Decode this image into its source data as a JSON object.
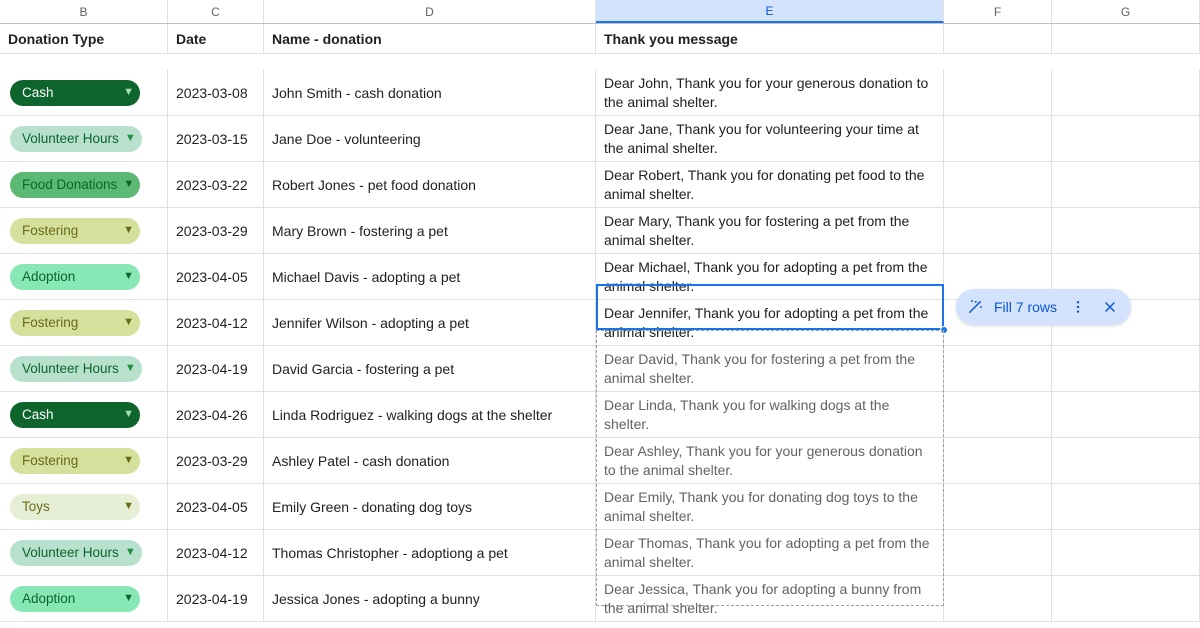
{
  "columns": [
    "B",
    "C",
    "D",
    "E",
    "F",
    "G"
  ],
  "selected_column_index": 3,
  "headers": {
    "donation_type": "Donation Type",
    "date": "Date",
    "name_donation": "Name - donation",
    "thank_you": "Thank you message"
  },
  "rows": [
    {
      "type": "Cash",
      "type_style": "cash",
      "date": "2023-03-08",
      "name": "John Smith - cash donation",
      "msg": "Dear John, Thank you for your generous donation to the animal shelter.",
      "suggested": false
    },
    {
      "type": "Volunteer Hours",
      "type_style": "vol",
      "date": "2023-03-15",
      "name": "Jane Doe - volunteering",
      "msg": "Dear Jane, Thank you for volunteering your time at the animal shelter.",
      "suggested": false
    },
    {
      "type": "Food Donations",
      "type_style": "food",
      "date": "2023-03-22",
      "name": "Robert Jones - pet food donation",
      "msg": "Dear Robert, Thank you for donating pet food to the animal shelter.",
      "suggested": false
    },
    {
      "type": "Fostering",
      "type_style": "fost",
      "date": "2023-03-29",
      "name": "Mary Brown - fostering a pet",
      "msg": "Dear Mary, Thank you for fostering a pet from the animal shelter.",
      "suggested": false
    },
    {
      "type": "Adoption",
      "type_style": "adopt",
      "date": "2023-04-05",
      "name": "Michael Davis - adopting a pet",
      "msg": "Dear Michael, Thank you for adopting a pet from the animal shelter.",
      "suggested": false
    },
    {
      "type": "Fostering",
      "type_style": "fost",
      "date": "2023-04-12",
      "name": "Jennifer Wilson - adopting a pet",
      "msg": "Dear Jennifer, Thank you for adopting a pet from the animal shelter.",
      "suggested": false,
      "active": true
    },
    {
      "type": "Volunteer Hours",
      "type_style": "vol",
      "date": "2023-04-19",
      "name": "David Garcia - fostering a pet",
      "msg": "Dear David, Thank you for fostering a pet from the animal shelter.",
      "suggested": true
    },
    {
      "type": "Cash",
      "type_style": "cash",
      "date": "2023-04-26",
      "name": "Linda Rodriguez - walking dogs at the shelter",
      "msg": "Dear Linda, Thank you for walking dogs at the shelter.",
      "suggested": true
    },
    {
      "type": "Fostering",
      "type_style": "fost",
      "date": "2023-03-29",
      "name": "Ashley Patel - cash donation",
      "msg": "Dear Ashley, Thank you for your generous donation to the animal shelter.",
      "suggested": true
    },
    {
      "type": "Toys",
      "type_style": "toys",
      "date": "2023-04-05",
      "name": "Emily Green - donating dog toys",
      "msg": "Dear Emily, Thank you for donating dog toys to the animal shelter.",
      "suggested": true
    },
    {
      "type": "Volunteer Hours",
      "type_style": "vol",
      "date": "2023-04-12",
      "name": "Thomas Christopher - adoptiong a pet",
      "msg": "Dear Thomas, Thank you for adopting a pet from the animal shelter.",
      "suggested": true
    },
    {
      "type": "Adoption",
      "type_style": "adopt",
      "date": "2023-04-19",
      "name": "Jessica Jones - adopting a bunny",
      "msg": "Dear Jessica, Thank you for adopting a bunny from the animal shelter.",
      "suggested": true
    }
  ],
  "fill_pill": {
    "label": "Fill 7 rows"
  }
}
